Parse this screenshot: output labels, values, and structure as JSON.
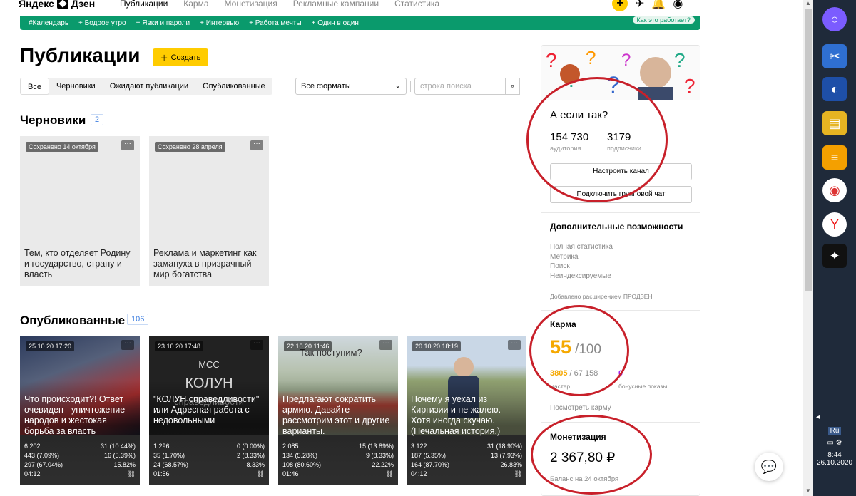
{
  "header": {
    "logo_text": "Яндекс",
    "logo_text2": "Дзен",
    "nav": [
      "Публикации",
      "Карма",
      "Монетизация",
      "Рекламные кампании",
      "Статистика"
    ],
    "plus_label": "+"
  },
  "banner": {
    "items": [
      "#Календарь",
      "+ Бодрое утро",
      "+ Явки и пароли",
      "+ Интервью",
      "+ Работа мечты",
      "+ Один в один"
    ],
    "how_label": "Как это работает?"
  },
  "page": {
    "title": "Публикации",
    "create_label": "Создать",
    "filters": [
      "Все",
      "Черновики",
      "Ожидают публикации",
      "Опубликованные"
    ],
    "format_select": "Все форматы",
    "search_placeholder": "строка поиска"
  },
  "drafts": {
    "heading": "Черновики",
    "count": "2",
    "items": [
      {
        "saved": "Сохранено 14 октября",
        "title": "Тем, кто отделяет Родину и государство, страну и власть"
      },
      {
        "saved": "Сохранено 28 апреля",
        "title": "Реклама и маркетинг как замануха в призрачный мир богатства"
      }
    ]
  },
  "published": {
    "heading": "Опубликованные",
    "count": "106",
    "items": [
      {
        "date": "25.10.20 17:20",
        "title": "Что происходит?! Ответ очевиден - уничтожение народов и жестокая борьба за власть",
        "views": "6 202",
        "likes": "31 (10.44%)",
        "reads": "443 (7.09%)",
        "dislikes": "16 (5.39%)",
        "ctr": "297 (67.04%)",
        "engagement": "15.82%",
        "time": "04:12",
        "overlay": ""
      },
      {
        "date": "23.10.20 17:48",
        "title": "\"КОЛУН справедливости\" или Адресная работа с недовольными",
        "views": "1 296",
        "likes": "0 (0.00%)",
        "reads": "35 (1.70%)",
        "dislikes": "2 (8.33%)",
        "ctr": "24 (68.57%)",
        "engagement": "8.33%",
        "time": "01:56",
        "overlay": "МСС\nКОЛУН\nсправедливости"
      },
      {
        "date": "22.10.20 11:46",
        "title": "Предлагают сократить армию. Давайте рассмотрим этот и другие варианты.",
        "views": "2 085",
        "likes": "15 (13.89%)",
        "reads": "134 (5.28%)",
        "dislikes": "9 (8.33%)",
        "ctr": "108 (80.60%)",
        "engagement": "22.22%",
        "time": "01:46",
        "overlay": "Так поступим?"
      },
      {
        "date": "20.10.20 18:19",
        "title": "Почему я уехал из Киргизии и не жалею. Хотя иногда скучаю. (Печальная история.)",
        "views": "3 122",
        "likes": "31 (18.90%)",
        "reads": "187 (5.35%)",
        "dislikes": "13 (7.93%)",
        "ctr": "164 (87.70%)",
        "engagement": "26.83%",
        "time": "04:12",
        "overlay": ""
      }
    ]
  },
  "sidebar": {
    "channel_name": "А если так?",
    "audience": "154 730",
    "audience_label": "аудитория",
    "subscribers": "3179",
    "subscribers_label": "подписчики",
    "btn_setup": "Настроить канал",
    "btn_chat": "Подключить групповой чат",
    "extra_title": "Дополнительные возможности",
    "extra_items": [
      "Полная статистика",
      "Метрика",
      "Поиск",
      "Неиндексируемые"
    ],
    "extra_note": "Добавлено расширением ПРОДЗЕН",
    "karma_title": "Карма",
    "karma_value": "55",
    "karma_max": "/100",
    "karma_points": "3805",
    "karma_points_total": "/ 67 158",
    "karma_points_label": "мастер",
    "karma_bonus": "0",
    "karma_bonus_label": "бонусные показы",
    "karma_link": "Посмотреть карму",
    "money_title": "Монетизация",
    "money_value": "2 367,80 ₽",
    "money_label": "Баланс на 24 октября"
  },
  "taskbar": {
    "lang": "Ru",
    "time": "8:44",
    "date": "26.10.2020"
  },
  "colors": {
    "accent": "#ffcc00",
    "green": "#0a9a6c",
    "karma": "#f5a800",
    "circle": "#c8202a"
  }
}
